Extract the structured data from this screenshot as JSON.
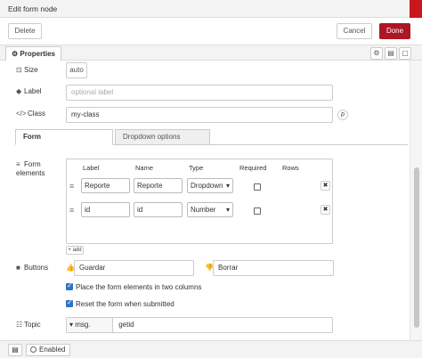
{
  "header": {
    "title": "Edit form node"
  },
  "toolbar": {
    "delete_label": "Delete",
    "cancel_label": "Cancel",
    "done_label": "Done"
  },
  "tabs": {
    "properties_label": "Properties"
  },
  "fields": {
    "size_label": "Size",
    "size_value": "auto",
    "label_label": "Label",
    "label_placeholder": "optional label",
    "class_label": "Class",
    "class_value": "my-class"
  },
  "subtabs": {
    "form": "Form",
    "dropdown": "Dropdown options"
  },
  "form_elements": {
    "label": "Form\nelements",
    "headers": {
      "label": "Label",
      "name": "Name",
      "type": "Type",
      "required": "Required",
      "rows": "Rows"
    },
    "rows": [
      {
        "label": "Reporte",
        "name": "Reporte",
        "type": "Dropdown",
        "required": false
      },
      {
        "label": "id",
        "name": "id",
        "type": "Number",
        "required": false
      }
    ],
    "add_label": "+ add"
  },
  "buttons": {
    "label": "Buttons",
    "submit_value": "Guardar",
    "cancel_value": "Borrar"
  },
  "options": {
    "two_columns": {
      "label": "Place the form elements in two columns",
      "checked": true
    },
    "reset": {
      "label": "Reset the form when submitted",
      "checked": true
    }
  },
  "topic": {
    "label": "Topic",
    "type": "msg.",
    "value": "getid"
  },
  "footer": {
    "enabled_label": "Enabled"
  },
  "colors": {
    "accent": "#ad1625",
    "checkbox": "#2f73c4"
  }
}
